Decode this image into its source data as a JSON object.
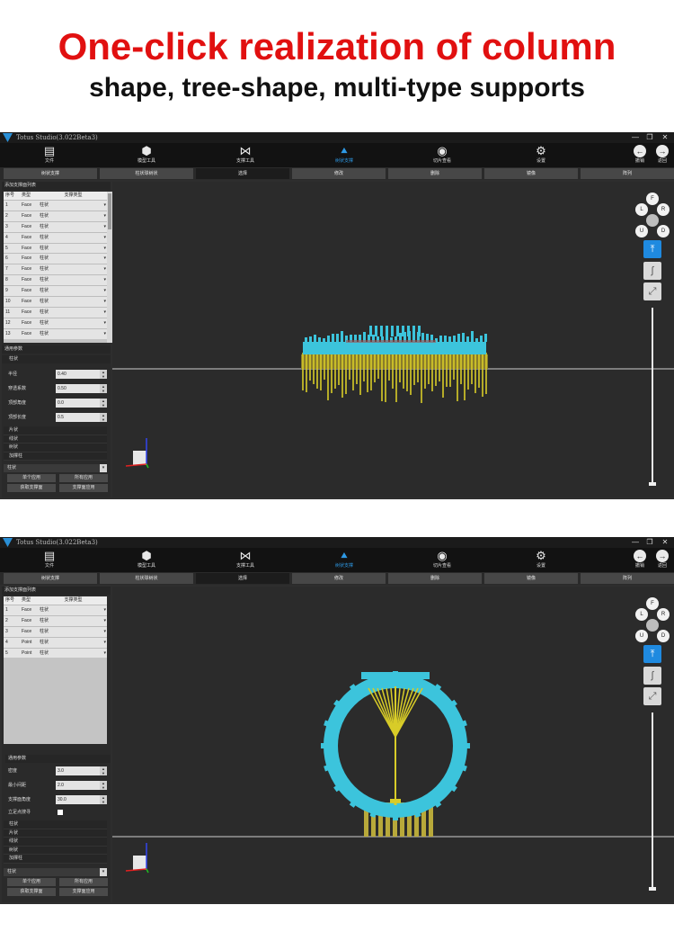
{
  "headline": "One-click realization of column",
  "subline": "shape, tree-shape, multi-type supports",
  "app": {
    "title": "Totus Studio(3.022Beta3)",
    "window_controls": [
      "—",
      "❐",
      "✕"
    ],
    "toolbar": [
      {
        "label": "文件",
        "icon": "file-icon",
        "glyph": "▤"
      },
      {
        "label": "模型工具",
        "icon": "cube-icon",
        "glyph": "⬢"
      },
      {
        "label": "支撑工具",
        "icon": "share-icon",
        "glyph": "⋈"
      },
      {
        "label": "树状支撑",
        "icon": "tree-icon",
        "glyph": "⯅"
      },
      {
        "label": "切片查看",
        "icon": "eye-icon",
        "glyph": "◉"
      },
      {
        "label": "设置",
        "icon": "gear-icon",
        "glyph": "⚙"
      }
    ],
    "nav": [
      {
        "label": "撤销",
        "glyph": "←"
      },
      {
        "label": "返回",
        "glyph": "→"
      }
    ],
    "tabs": [
      "树状支撑",
      "柱状球树状",
      "选择",
      "修改",
      "删除",
      "镜像",
      "阵列"
    ],
    "view_cube": [
      "F",
      "L",
      "R",
      "U",
      "D"
    ],
    "view_tools": {
      "top": "⤒",
      "curve": "∫",
      "expand": "⤢"
    }
  },
  "panel1": {
    "section_title": "添加支撑面列表",
    "columns": [
      "序号",
      "类型",
      "支撑类型"
    ],
    "rows": [
      {
        "no": "1",
        "type": "Face",
        "support": "柱状"
      },
      {
        "no": "2",
        "type": "Face",
        "support": "柱状"
      },
      {
        "no": "3",
        "type": "Face",
        "support": "柱状"
      },
      {
        "no": "4",
        "type": "Face",
        "support": "柱状"
      },
      {
        "no": "5",
        "type": "Face",
        "support": "柱状"
      },
      {
        "no": "6",
        "type": "Face",
        "support": "柱状"
      },
      {
        "no": "7",
        "type": "Face",
        "support": "柱状"
      },
      {
        "no": "8",
        "type": "Face",
        "support": "柱状"
      },
      {
        "no": "9",
        "type": "Face",
        "support": "柱状"
      },
      {
        "no": "10",
        "type": "Face",
        "support": "柱状"
      },
      {
        "no": "11",
        "type": "Face",
        "support": "柱状"
      },
      {
        "no": "12",
        "type": "Face",
        "support": "柱状"
      },
      {
        "no": "13",
        "type": "Face",
        "support": "柱状"
      }
    ],
    "params_title": "通用参数",
    "sub_title": "柱状",
    "params": [
      {
        "label": "半径",
        "value": "0.40"
      },
      {
        "label": "穿透系数",
        "value": "0.50"
      },
      {
        "label": "顶部角度",
        "value": "0.0"
      },
      {
        "label": "顶部长度",
        "value": "0.5"
      }
    ],
    "list": [
      "片状",
      "线状",
      "树状",
      "加撑柱"
    ],
    "select_value": "柱状",
    "buttons": [
      "单个应用",
      "所有应用",
      "获取支撑面",
      "支撑面应用"
    ]
  },
  "panel2": {
    "section_title": "添加支撑面列表",
    "columns": [
      "序号",
      "类型",
      "支撑类型"
    ],
    "rows": [
      {
        "no": "1",
        "type": "Face",
        "support": "柱状"
      },
      {
        "no": "2",
        "type": "Face",
        "support": "柱状"
      },
      {
        "no": "3",
        "type": "Face",
        "support": "柱状"
      },
      {
        "no": "4",
        "type": "Point",
        "support": "柱状"
      },
      {
        "no": "5",
        "type": "Point",
        "support": "柱状"
      }
    ],
    "params_title": "通用参数",
    "params": [
      {
        "label": "密度",
        "value": "3.0"
      },
      {
        "label": "最小间距",
        "value": "2.0"
      },
      {
        "label": "支撑面角度",
        "value": "30.0"
      }
    ],
    "checkbox_label": "立足点搜寻",
    "list": [
      "柱状",
      "片状",
      "线状",
      "树状",
      "加撑柱"
    ],
    "select_value": "柱状",
    "buttons": [
      "单个应用",
      "所有应用",
      "获取支撑面",
      "支撑面应用"
    ]
  },
  "colors": {
    "accent": "#2e9ae6",
    "headline": "#e11010",
    "model": "#3cc4dc",
    "support": "#d8cc28"
  }
}
